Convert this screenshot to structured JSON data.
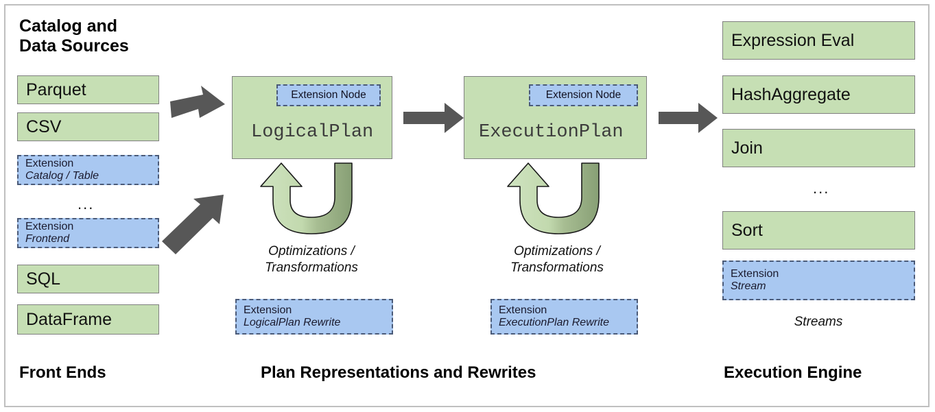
{
  "diagram": {
    "title_left": "Catalog and\nData Sources",
    "columns": {
      "left": {
        "footer": "Front Ends",
        "items": [
          {
            "kind": "green",
            "label": "Parquet"
          },
          {
            "kind": "green",
            "label": "CSV"
          },
          {
            "kind": "extension",
            "label": "Extension",
            "sub": "Catalog / Table"
          },
          {
            "kind": "ellipsis",
            "label": "..."
          },
          {
            "kind": "extension",
            "label": "Extension",
            "sub": "Frontend"
          },
          {
            "kind": "green",
            "label": "SQL"
          },
          {
            "kind": "green",
            "label": "DataFrame"
          }
        ]
      },
      "middle": {
        "footer": "Plan Representations and Rewrites",
        "stages": [
          {
            "plan_name": "LogicalPlan",
            "node_chip": "Extension Node",
            "loop_caption": "Optimizations /\nTransformations",
            "extension": {
              "label": "Extension",
              "sub": "LogicalPlan Rewrite"
            }
          },
          {
            "plan_name": "ExecutionPlan",
            "node_chip": "Extension Node",
            "loop_caption": "Optimizations /\nTransformations",
            "extension": {
              "label": "Extension",
              "sub": "ExecutionPlan Rewrite"
            }
          }
        ]
      },
      "right": {
        "footer": "Execution Engine",
        "caption": "Streams",
        "items": [
          {
            "kind": "green",
            "label": "Expression Eval"
          },
          {
            "kind": "green",
            "label": "HashAggregate"
          },
          {
            "kind": "green",
            "label": "Join"
          },
          {
            "kind": "ellipsis",
            "label": "..."
          },
          {
            "kind": "green",
            "label": "Sort"
          },
          {
            "kind": "extension",
            "label": "Extension",
            "sub": "Stream"
          }
        ]
      }
    },
    "colors": {
      "green_fill": "#c6dfb4",
      "green_border": "#7f7f7f",
      "blue_fill": "#a9c8f1",
      "blue_border": "#4a5a78",
      "arrow_gray": "#575757",
      "loop_arrow_light": "#c6dfb4",
      "loop_arrow_dark": "#8ba679",
      "frame_border": "#bfbfbf"
    }
  }
}
